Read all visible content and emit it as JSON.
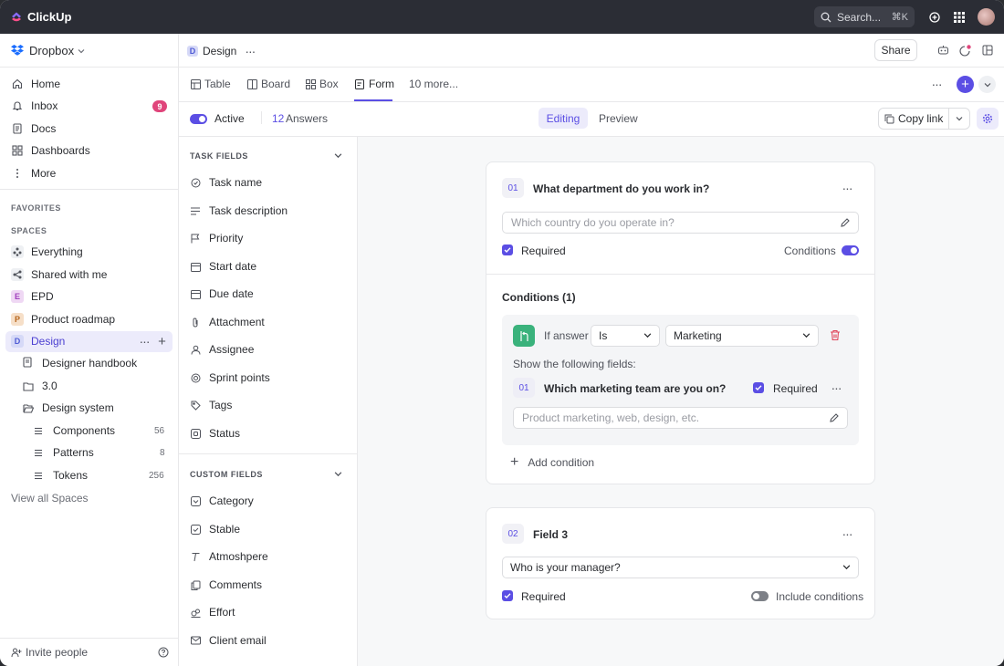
{
  "topbar": {
    "app_name": "ClickUp",
    "search_placeholder": "Search...",
    "search_shortcut": "⌘K"
  },
  "sidebar": {
    "workspace": "Dropbox",
    "nav": [
      {
        "label": "Home",
        "icon": "home-icon"
      },
      {
        "label": "Inbox",
        "icon": "bell-icon",
        "badge": "9"
      },
      {
        "label": "Docs",
        "icon": "doc-icon"
      },
      {
        "label": "Dashboards",
        "icon": "dashboard-icon"
      },
      {
        "label": "More",
        "icon": "more-vertical-icon"
      }
    ],
    "favorites_label": "FAVORITES",
    "spaces_label": "SPACES",
    "spaces": [
      {
        "label": "Everything"
      },
      {
        "label": "Shared with me"
      },
      {
        "label": "EPD",
        "letter": "E"
      },
      {
        "label": "Product roadmap",
        "letter": "P"
      },
      {
        "label": "Design",
        "letter": "D"
      }
    ],
    "design_children": [
      {
        "label": "Designer handbook"
      },
      {
        "label": "3.0"
      },
      {
        "label": "Design system"
      }
    ],
    "lists": [
      {
        "label": "Components",
        "count": "56"
      },
      {
        "label": "Patterns",
        "count": "8"
      },
      {
        "label": "Tokens",
        "count": "256"
      }
    ],
    "view_all": "View all Spaces",
    "invite": "Invite people"
  },
  "header": {
    "crumb_letter": "D",
    "crumb_title": "Design",
    "share_label": "Share"
  },
  "tabs": [
    {
      "label": "Table"
    },
    {
      "label": "Board"
    },
    {
      "label": "Box"
    },
    {
      "label": "Form"
    },
    {
      "label": "10 more..."
    }
  ],
  "toolbar": {
    "active_label": "Active",
    "answers_count": "12",
    "answers_label": "Answers",
    "editing_label": "Editing",
    "preview_label": "Preview",
    "copy_link_label": "Copy link"
  },
  "fields": {
    "task_section": "TASK FIELDS",
    "task_items": [
      "Task name",
      "Task description",
      "Priority",
      "Start date",
      "Due date",
      "Attachment",
      "Assignee",
      "Sprint points",
      "Tags",
      "Status"
    ],
    "custom_section": "CUSTOM FIELDS",
    "custom_items": [
      "Category",
      "Stable",
      "Atmoshpere",
      "Comments",
      "Effort",
      "Client email"
    ]
  },
  "form": {
    "q1": {
      "number": "01",
      "title": "What department do you work in?",
      "placeholder": "Which country do you operate in?",
      "required_label": "Required",
      "conditions_toggle_label": "Conditions"
    },
    "conditions": {
      "heading": "Conditions (1)",
      "if_answer_label": "If answer",
      "operator": "Is",
      "value": "Marketing",
      "show_label": "Show the following fields:",
      "sub_number": "01",
      "sub_title": "Which marketing team are you on?",
      "sub_required_label": "Required",
      "sub_placeholder": "Product marketing, web, design, etc.",
      "add_label": "Add condition"
    },
    "q2": {
      "number": "02",
      "title": "Field 3",
      "select_value": "Who is your manager?",
      "required_label": "Required",
      "include_label": "Include conditions"
    }
  },
  "colors": {
    "accent": "#5b4ee4",
    "topbar": "#2b2d35",
    "badge": "#e0457b",
    "danger": "#e0455a",
    "condition_icon": "#3ab27c"
  }
}
